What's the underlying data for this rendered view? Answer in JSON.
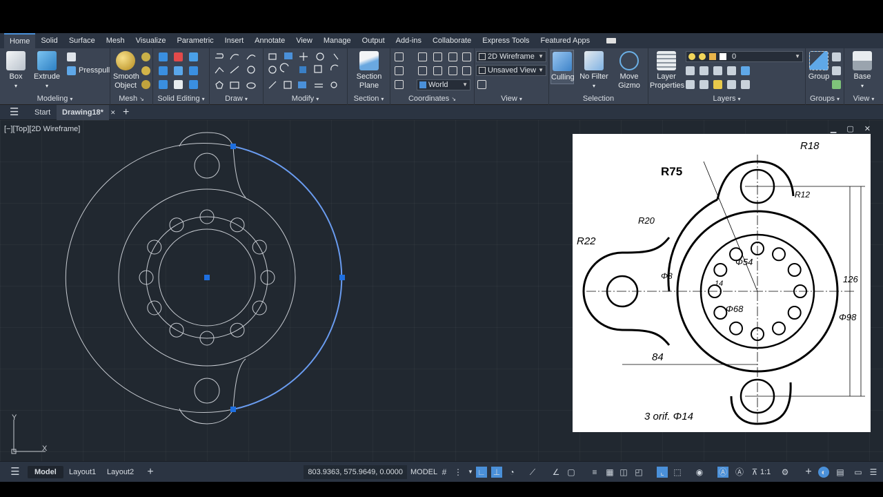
{
  "ribbon_tabs": [
    "Home",
    "Solid",
    "Surface",
    "Mesh",
    "Visualize",
    "Parametric",
    "Insert",
    "Annotate",
    "View",
    "Manage",
    "Output",
    "Add-ins",
    "Collaborate",
    "Express Tools",
    "Featured Apps"
  ],
  "active_tab": "Home",
  "panels": {
    "modeling": {
      "title": "Modeling",
      "box": "Box",
      "extrude": "Extrude",
      "presspull": "Presspull"
    },
    "mesh": {
      "title": "Mesh",
      "smooth_line1": "Smooth",
      "smooth_line2": "Object"
    },
    "solid_editing": {
      "title": "Solid Editing"
    },
    "draw": {
      "title": "Draw"
    },
    "modify": {
      "title": "Modify"
    },
    "section": {
      "title": "Section",
      "btn_line1": "Section",
      "btn_line2": "Plane"
    },
    "coordinates": {
      "title": "Coordinates",
      "world": "World"
    },
    "view": {
      "title": "View",
      "visual_style": "2D Wireframe",
      "named_view": "Unsaved View"
    },
    "selection": {
      "title": "Selection",
      "culling": "Culling",
      "no_filter": "No Filter",
      "move_line1": "Move",
      "move_line2": "Gizmo"
    },
    "layers": {
      "title": "Layers",
      "lp_line1": "Layer",
      "lp_line2": "Properties",
      "current_layer": "0"
    },
    "groups": {
      "title": "Groups",
      "group": "Group"
    },
    "view2": {
      "title": "View",
      "base": "Base"
    }
  },
  "file_tabs": {
    "start": "Start",
    "drawing": "Drawing18*"
  },
  "viewport_label": "[−][Top][2D Wireframe]",
  "ucs": {
    "x": "X",
    "y": "Y"
  },
  "status": {
    "layouts": [
      "Model",
      "Layout1",
      "Layout2"
    ],
    "coords": "803.9363, 575.9649, 0.0000",
    "model": "MODEL",
    "scale": "1:1"
  },
  "reference_drawing": {
    "r75": "R75",
    "r18": "R18",
    "r12": "R12",
    "r20": "R20",
    "r22": "R22",
    "d8": "Φ8",
    "d14": "14",
    "d54": "Φ54",
    "d68": "Φ68",
    "d98": "Φ98",
    "h126": "126",
    "w84": "84",
    "holes": "3 orif. Φ14"
  },
  "colors": {
    "accent": "#4a90d9",
    "selection": "#6a9cf0",
    "grip": "#1e6fe0",
    "ribbon": "#3b4453",
    "canvas": "#212830"
  }
}
